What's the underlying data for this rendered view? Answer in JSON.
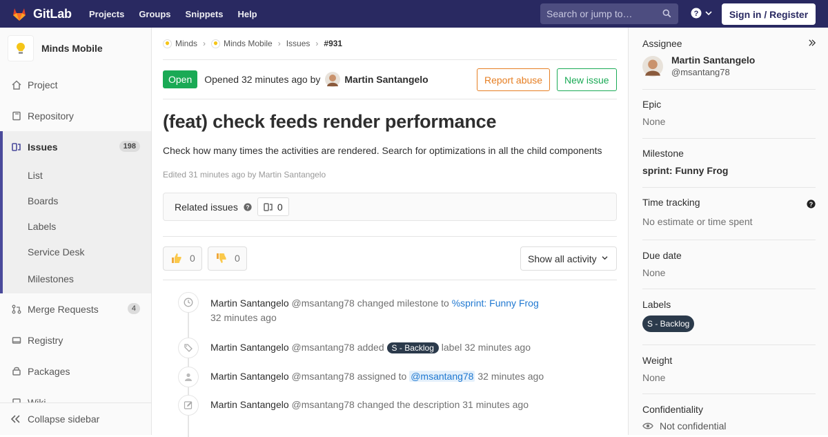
{
  "topbar": {
    "brand": "GitLab",
    "nav": [
      "Projects",
      "Groups",
      "Snippets",
      "Help"
    ],
    "search_placeholder": "Search or jump to…",
    "signin": "Sign in / Register"
  },
  "sidebar": {
    "project_name": "Minds Mobile",
    "items": {
      "project": "Project",
      "repository": "Repository",
      "issues": "Issues",
      "issues_count": "198",
      "merge_requests": "Merge Requests",
      "merge_requests_count": "4",
      "registry": "Registry",
      "packages": "Packages",
      "wiki": "Wiki"
    },
    "issues_sub": [
      "List",
      "Boards",
      "Labels",
      "Service Desk",
      "Milestones"
    ],
    "collapse": "Collapse sidebar"
  },
  "breadcrumbs": [
    "Minds",
    "Minds Mobile",
    "Issues",
    "#931"
  ],
  "issue": {
    "status": "Open",
    "opened_prefix": "Opened 32 minutes ago by",
    "author": "Martin Santangelo",
    "report_abuse": "Report abuse",
    "new_issue": "New issue",
    "title": "(feat) check feeds render performance",
    "description": "Check how many times the activities are rendered. Search for optimizations in all the child components",
    "edited": "Edited 31 minutes ago by Martin Santangelo",
    "related_label": "Related issues",
    "related_count": "0",
    "thumbs_up": "0",
    "thumbs_down": "0",
    "show_activity": "Show all activity"
  },
  "timeline": [
    {
      "user": "Martin Santangelo",
      "handle": "@msantang78",
      "action": "changed milestone to",
      "link": "%sprint: Funny Frog",
      "time": "32 minutes ago",
      "icon": "clock-icon"
    },
    {
      "user": "Martin Santangelo",
      "handle": "@msantang78",
      "action": "added",
      "label": "S - Backlog",
      "after": "label",
      "time": "32 minutes ago",
      "icon": "tag-icon"
    },
    {
      "user": "Martin Santangelo",
      "handle": "@msantang78",
      "action": "assigned to",
      "mention": "@msantang78",
      "time": "32 minutes ago",
      "icon": "user-icon"
    },
    {
      "user": "Martin Santangelo",
      "handle": "@msantang78",
      "action": "changed the description",
      "time": "31 minutes ago",
      "icon": "pencil-icon"
    }
  ],
  "right_sidebar": {
    "assignee_head": "Assignee",
    "assignee_name": "Martin Santangelo",
    "assignee_handle": "@msantang78",
    "epic_head": "Epic",
    "epic_val": "None",
    "milestone_head": "Milestone",
    "milestone_val": "sprint: Funny Frog",
    "time_head": "Time tracking",
    "time_val": "No estimate or time spent",
    "due_head": "Due date",
    "due_val": "None",
    "labels_head": "Labels",
    "labels_val": "S - Backlog",
    "weight_head": "Weight",
    "weight_val": "None",
    "conf_head": "Confidentiality",
    "conf_val": "Not confidential"
  },
  "colors": {
    "navbar": "#292961",
    "open_badge": "#1aaa55",
    "report_abuse": "#e67e22",
    "link": "#1f78d1",
    "label_bg": "#2b3a4b"
  }
}
